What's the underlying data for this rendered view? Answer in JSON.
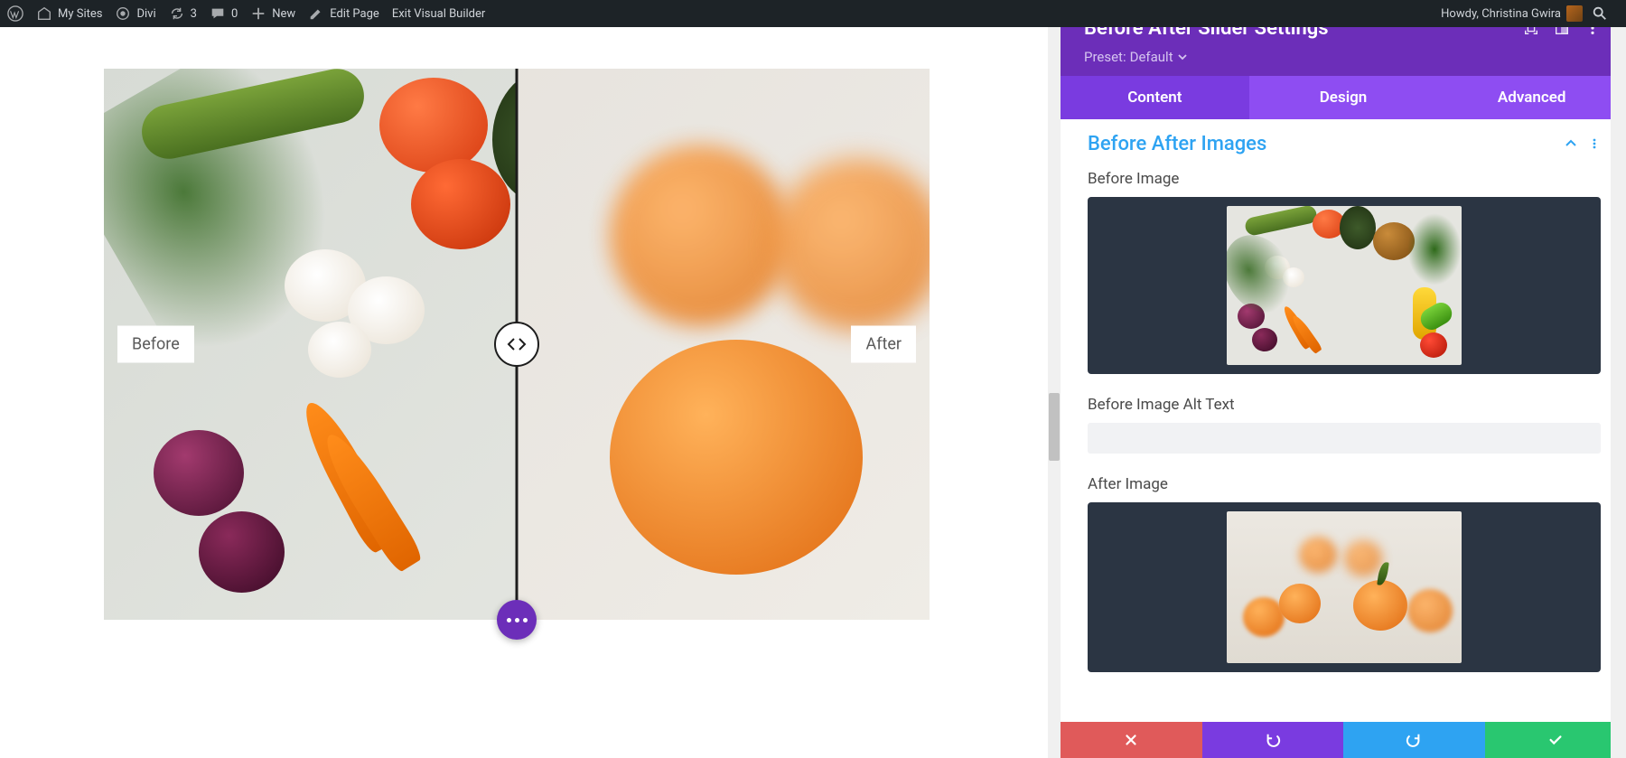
{
  "adminbar": {
    "my_sites": "My Sites",
    "site_name": "Divi",
    "updates": "3",
    "comments": "0",
    "new": "New",
    "edit_page": "Edit Page",
    "exit_vb": "Exit Visual Builder",
    "howdy": "Howdy, Christina Gwira"
  },
  "slider": {
    "before_label": "Before",
    "after_label": "After"
  },
  "panel": {
    "title": "Before After Slider Settings",
    "preset_prefix": "Preset:",
    "preset_value": "Default",
    "tabs": {
      "content": "Content",
      "design": "Design",
      "advanced": "Advanced"
    },
    "section_title": "Before After Images",
    "before_image_label": "Before Image",
    "before_alt_label": "Before Image Alt Text",
    "before_alt_value": "",
    "after_image_label": "After Image"
  }
}
